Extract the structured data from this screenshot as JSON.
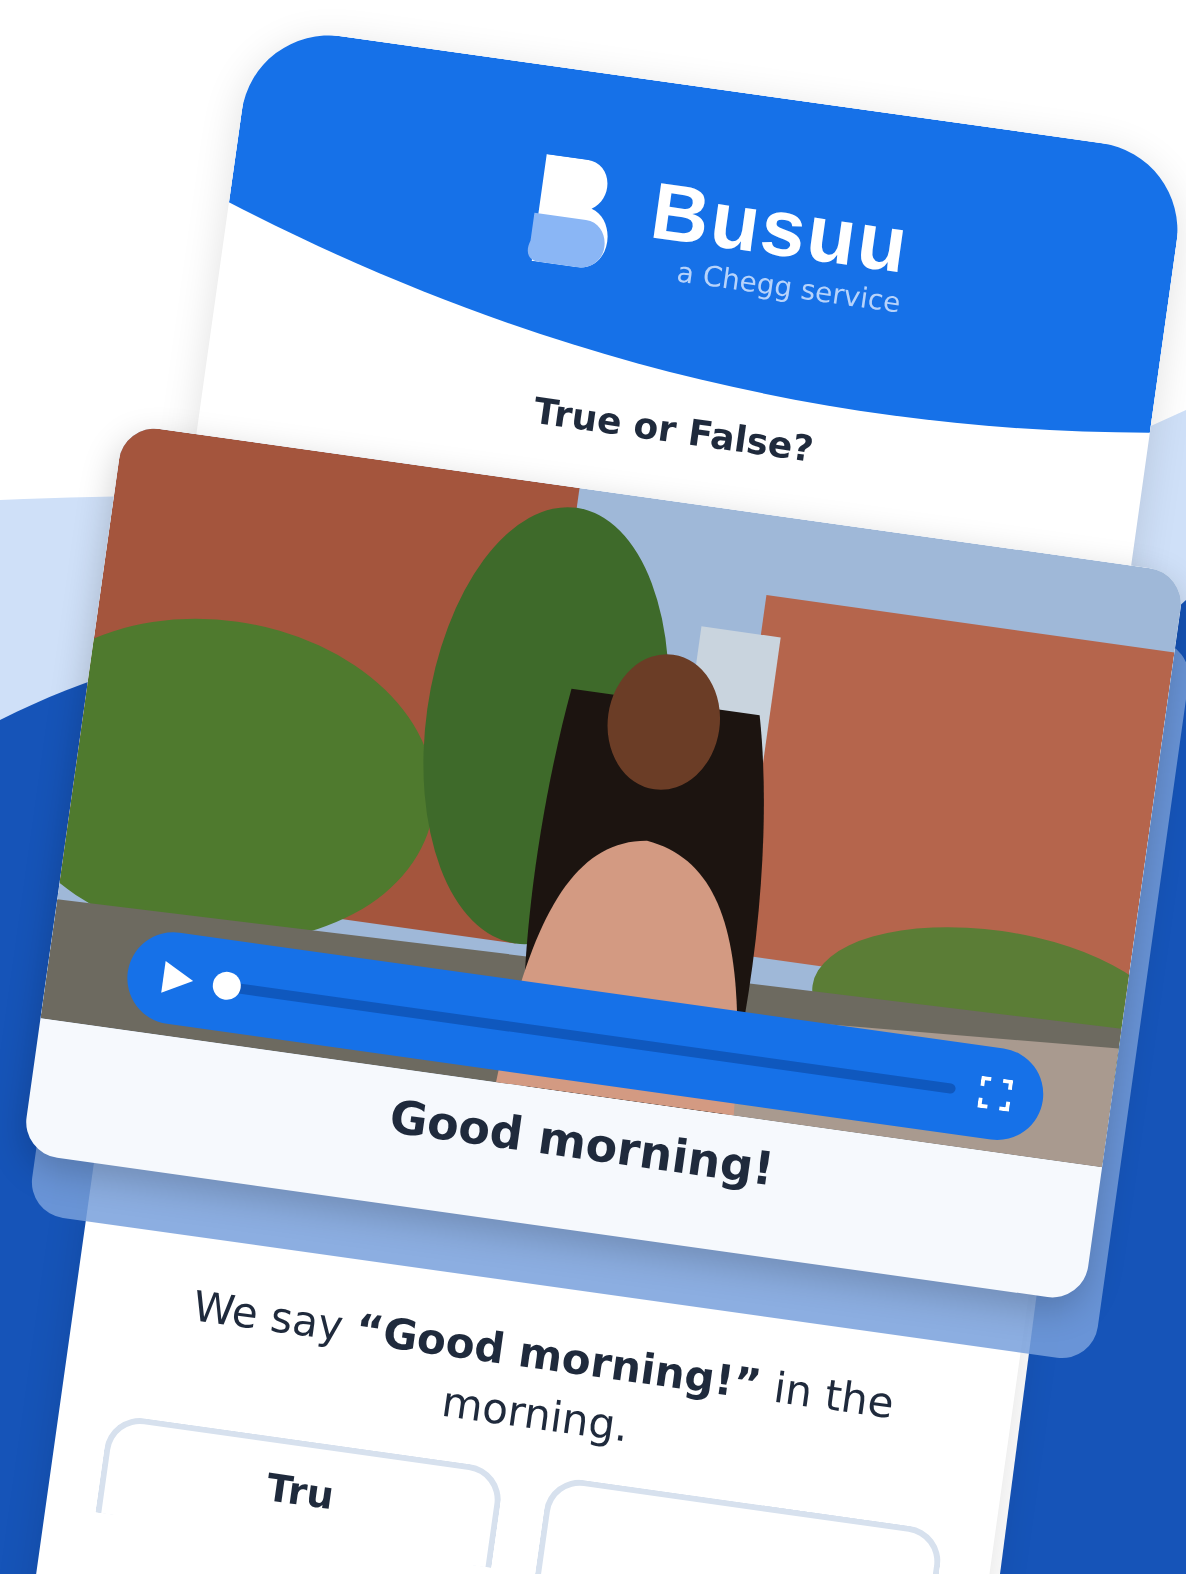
{
  "logo": {
    "name": "Busuu",
    "tagline": "a Chegg service"
  },
  "question": "True or False?",
  "video": {
    "progress": {
      "level": 0.01
    },
    "caption": "Good morning!"
  },
  "sentence": "We say **“Good morning!”** in the morning.",
  "answers": [
    {
      "kind": "text",
      "label": "Tru"
    },
    {
      "kind": "blank"
    }
  ]
}
